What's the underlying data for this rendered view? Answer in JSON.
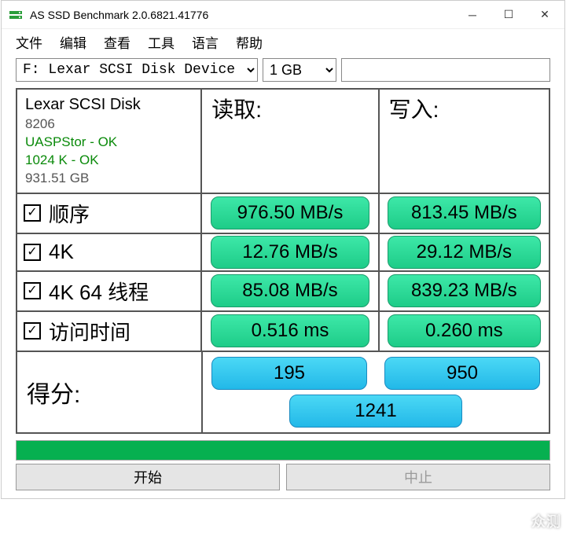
{
  "title": "AS SSD Benchmark 2.0.6821.41776",
  "menu": [
    "文件",
    "编辑",
    "查看",
    "工具",
    "语言",
    "帮助"
  ],
  "drive_select": "F: Lexar  SCSI Disk Device",
  "size_select": "1 GB",
  "info": {
    "model": "Lexar SCSI Disk",
    "fw": "8206",
    "driver_ok": "UASPStor - OK",
    "align_ok": "1024 K - OK",
    "capacity": "931.51 GB"
  },
  "headers": {
    "read": "读取:",
    "write": "写入:"
  },
  "rows": {
    "seq": {
      "label": "顺序",
      "read": "976.50 MB/s",
      "write": "813.45 MB/s"
    },
    "k4": {
      "label": "4K",
      "read": "12.76 MB/s",
      "write": "29.12 MB/s"
    },
    "k4_64": {
      "label": "4K 64 线程",
      "read": "85.08 MB/s",
      "write": "839.23 MB/s"
    },
    "acc": {
      "label": "访问时间",
      "read": "0.516 ms",
      "write": "0.260 ms"
    }
  },
  "score": {
    "label": "得分:",
    "read": "195",
    "write": "950",
    "total": "1241"
  },
  "buttons": {
    "start": "开始",
    "abort": "中止"
  },
  "watermark": "众测"
}
